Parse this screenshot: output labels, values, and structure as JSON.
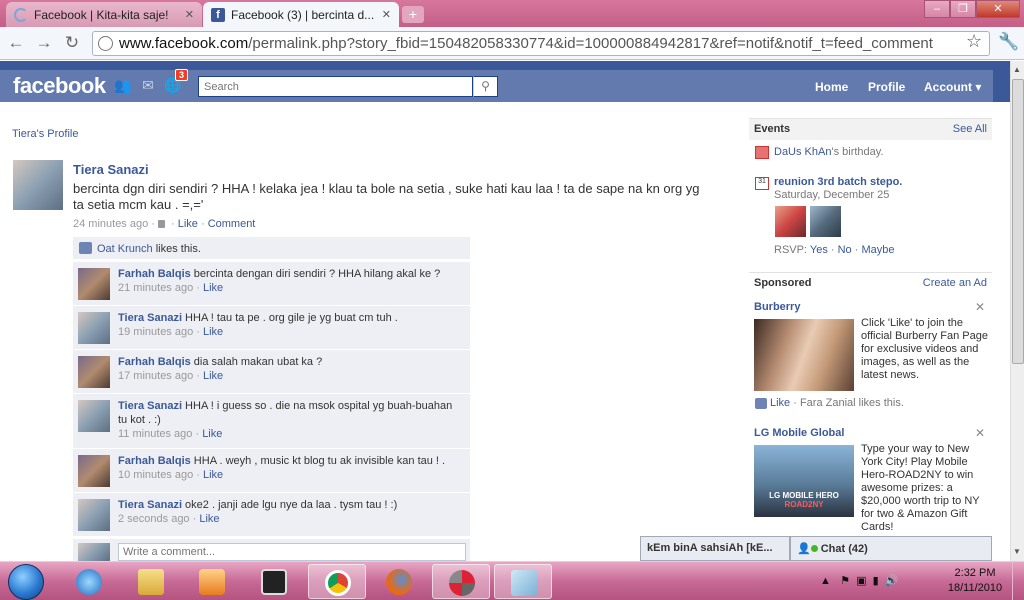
{
  "browser": {
    "tabs": [
      {
        "title": "Facebook | Kita-kita saje!",
        "active": false
      },
      {
        "title": "Facebook (3) | bercinta d...",
        "active": true
      }
    ],
    "url_host": "www.facebook.com",
    "url_rest": "/permalink.php?story_fbid=150482058330774&id=100000884942817&ref=notif&notif_t=feed_comment"
  },
  "fb_header": {
    "logo": "facebook",
    "notif_count": "3",
    "search_placeholder": "Search",
    "nav": {
      "home": "Home",
      "profile": "Profile",
      "account": "Account ▾"
    }
  },
  "breadcrumb": "Tiera's Profile",
  "post": {
    "author": "Tiera Sanazi",
    "text": "bercinta dgn diri sendiri ? HHA ! kelaka jea ! klau ta bole na setia , suke hati kau laa ! ta de sape na kn org yg ta setia mcm kau . =,='",
    "time": "24 minutes ago ·",
    "like": "Like",
    "comment": "Comment",
    "liker": "Oat Krunch",
    "likes_suffix": " likes this."
  },
  "comments": [
    {
      "name": "Farhah Balqis",
      "text": " bercinta dengan diri sendiri ? HHA hilang akal ke ?",
      "time": "21 minutes ago · ",
      "like": "Like"
    },
    {
      "name": "Tiera Sanazi",
      "text": " HHA ! tau ta pe . org gile je yg buat cm tuh .",
      "time": "19 minutes ago · ",
      "like": "Like"
    },
    {
      "name": "Farhah Balqis",
      "text": " dia salah makan ubat ka ?",
      "time": "17 minutes ago · ",
      "like": "Like"
    },
    {
      "name": "Tiera Sanazi",
      "text": " HHA ! i guess so . die na msok ospital yg buah-buahan tu kot . :)",
      "time": "11 minutes ago · ",
      "like": "Like"
    },
    {
      "name": "Farhah Balqis",
      "text": " HHA . weyh , music kt blog tu ak invisible kan tau ! .",
      "time": "10 minutes ago · ",
      "like": "Like"
    },
    {
      "name": "Tiera Sanazi",
      "text": " oke2 . janji ade lgu nye da laa . tysm tau ! :)",
      "time": "2 seconds ago · ",
      "like": "Like"
    }
  ],
  "write_comment_placeholder": "Write a comment...",
  "events": {
    "title": "Events",
    "see_all": "See All",
    "birthday_name": "DaUs KhAn",
    "birthday_suffix": "'s birthday.",
    "event_title": "reunion 3rd batch stepo.",
    "event_date": "Saturday, December 25",
    "calendar_day": "31",
    "rsvp_label": "RSVP: ",
    "rsvp_yes": "Yes",
    "rsvp_no": "No",
    "rsvp_maybe": "Maybe"
  },
  "sponsored": {
    "title": "Sponsored",
    "create_ad": "Create an Ad",
    "ads": [
      {
        "title": "Burberry",
        "text": "Click 'Like' to join the official Burberry Fan Page for exclusive videos and images, as well as the latest news.",
        "like": "Like",
        "like_note": " · Fara Zanial likes this."
      },
      {
        "title": "LG Mobile Global",
        "text": "Type your way to New York City! Play Mobile Hero-ROAD2NY to win awesome prizes: a $20,000 worth trip to NY for two & Amazon Gift Cards!",
        "image_caption_1": "LG MOBILE HERO",
        "image_caption_2": "ROAD2NY"
      }
    ]
  },
  "chat": {
    "tab_label": "kEm binA sahsiAh [kE...",
    "label": "Chat",
    "count": "(42)"
  },
  "taskbar": {
    "time": "2:32 PM",
    "date": "18/11/2010"
  },
  "colors": {
    "fb_blue": "#3b5998",
    "fb_light": "#627aad",
    "comment_bg": "#edeff4",
    "taskbar": "#c86b97"
  }
}
